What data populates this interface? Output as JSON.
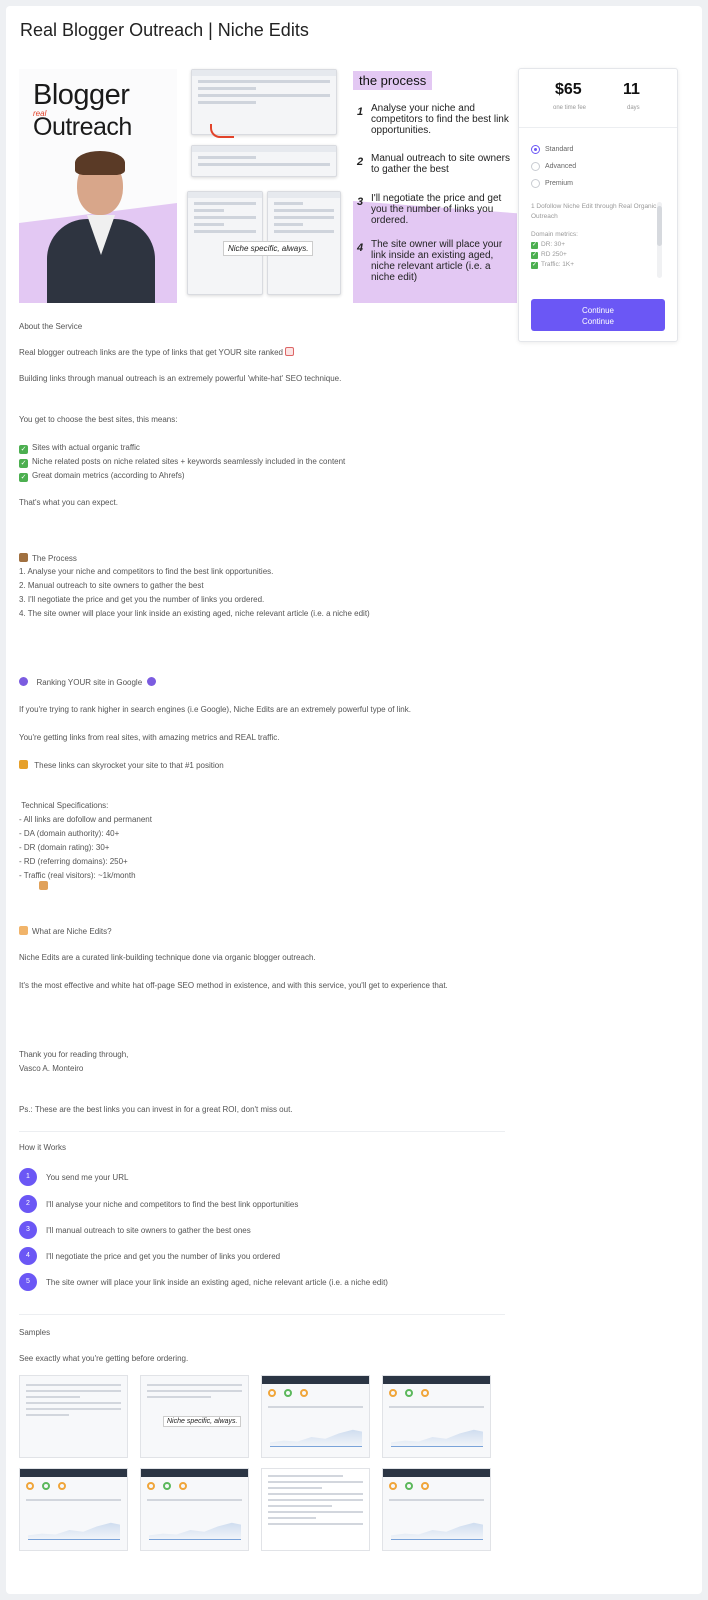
{
  "page": {
    "title": "Real Blogger Outreach | Niche Edits"
  },
  "hero": {
    "blogger": "Blogger",
    "real": "real",
    "outreach": "Outreach",
    "niche_tag": "Niche specific, always.",
    "process_title": "the process",
    "process_steps": [
      {
        "num": "1",
        "text": "Analyse your niche and competitors to find the best link opportunities."
      },
      {
        "num": "2",
        "text": "Manual outreach to site owners to gather the best"
      },
      {
        "num": "3",
        "text": "I'll negotiate the price and get you the number of links you ordered."
      },
      {
        "num": "4",
        "text": "The site owner will place your link inside an existing aged, niche relevant article (i.e. a niche edit)"
      }
    ]
  },
  "pricing": {
    "price": "$65",
    "price_sub": "one time fee",
    "days": "11",
    "days_sub": "days",
    "options": [
      "Standard",
      "Advanced",
      "Premium"
    ],
    "selected_option": "Standard",
    "description": "1 Dofollow Niche Edit through Real Organic Outreach",
    "metrics_label": "Domain metrics:",
    "metrics": [
      "DR: 30+",
      "RD 250+",
      "Traffic: 1K+"
    ],
    "continue_label_1": "Continue",
    "continue_label_2": "Continue",
    "accent_color": "#6b57f5"
  },
  "about": {
    "heading": "About the Service",
    "line1": "Real blogger outreach links are the type of links that get YOUR site ranked",
    "line2": "Building links through manual outreach is an extremely powerful 'white-hat' SEO technique.",
    "line3": "You get to choose the best sites, this means:",
    "checks": [
      "Sites with actual organic traffic",
      "Niche related posts on niche related sites + keywords seamlessly included in the content",
      "Great domain metrics (according to Ahrefs)"
    ],
    "line4": "That's what you can expect.",
    "process_heading": "The Process",
    "process_items": [
      "1. Analyse your niche and competitors to find the best link opportunities.",
      "2. Manual outreach to site owners to gather the best",
      "3. I'll negotiate the price and get you the number of links you ordered.",
      "4. The site owner will place your link inside an existing aged, niche relevant article (i.e. a niche edit)"
    ],
    "ranking_heading": "Ranking YOUR site in Google",
    "ranking_line1": "If you're trying to rank higher in search engines (i.e Google), Niche Edits are an extremely powerful type of link.",
    "ranking_line2": "You're getting links from real sites, with amazing metrics and REAL traffic.",
    "ranking_line3": "These links can skyrocket your site to that #1 position",
    "tech_heading": "Technical Specifications:",
    "tech_items": [
      "- All links are dofollow and permanent",
      "- DA (domain authority): 40+",
      "- DR (domain rating): 30+",
      "- RD (referring domains): 250+",
      "- Traffic (real visitors): ~1k/month"
    ],
    "niche_heading": "What are Niche Edits?",
    "niche_line1": "Niche Edits are a curated link-building technique done via organic blogger outreach.",
    "niche_line2": "It's the most effective and white hat off-page SEO method in existence, and with this service, you'll get to experience that.",
    "thanks": "Thank you for reading through,",
    "author": "Vasco A. Monteiro",
    "ps": "Ps.: These are the best links you can invest in for a great ROI, don't miss out."
  },
  "how_it_works": {
    "title": "How it Works",
    "steps": [
      {
        "num": "1",
        "text": "You send me your URL"
      },
      {
        "num": "2",
        "text": "I'll analyse your niche and competitors to find the best link opportunities"
      },
      {
        "num": "3",
        "text": "I'll manual outreach to site owners to gather the best ones"
      },
      {
        "num": "4",
        "text": "I'll negotiate the price and get you the number of links you ordered"
      },
      {
        "num": "5",
        "text": "The site owner will place your link inside an existing aged, niche relevant article (i.e. a niche edit)"
      }
    ]
  },
  "samples": {
    "title": "Samples",
    "subtitle": "See exactly what you're getting before ordering.",
    "niche_tag": "Niche specific, always."
  }
}
